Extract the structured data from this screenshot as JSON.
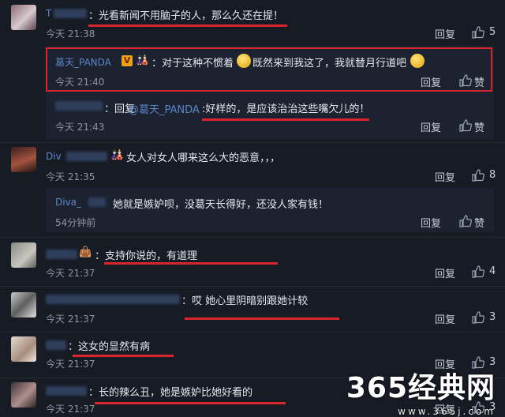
{
  "comments": [
    {
      "text": "：光看新闻不用脑子的人，那么久还在提！",
      "time": "今天 21:38",
      "reply": "回复",
      "likes": "5"
    },
    {
      "text": "女人对女人哪来这么大的恶意，，，",
      "time": "今天 21:35",
      "reply": "回复",
      "likes": "8"
    },
    {
      "text": "：支持你说的，有道理",
      "time": "今天 21:37",
      "reply": "回复",
      "likes": "4"
    },
    {
      "text": "：哎  她心里阴暗别跟她计较",
      "time": "今天 21:37",
      "reply": "回复",
      "likes": "3"
    },
    {
      "text": "：这女的显然有病",
      "time": "今天 21:37",
      "reply": "回复",
      "likes": "3"
    },
    {
      "text": "：长的辣么丑，她是嫉妒比她好看的",
      "time": "今天 21:37",
      "reply": "回复",
      "likes": "3"
    }
  ],
  "subreplies": [
    {
      "user": "葛天_PANDA",
      "text_a": "：对于这种不惯着",
      "text_b": "既然来到我这了，我就替月行道吧",
      "time": "今天 21:40",
      "reply": "回复",
      "like": "赞"
    },
    {
      "prefix": "：回复",
      "mention": "@葛天_PANDA",
      "text": ":好样的，是应该治治这些嘴欠儿的！",
      "time": "今天 21:43",
      "reply": "回复",
      "like": "赞"
    },
    {
      "user": "Diva_",
      "text": "她就是嫉妒呗，没葛天长得好，还没人家有钱！",
      "time": "54分钟前",
      "reply": "回复",
      "like": "赞"
    }
  ],
  "user_fragments": {
    "c1": "T",
    "c2": "Div"
  },
  "badges": {
    "v": "V"
  },
  "watermark": {
    "main": "365经典网",
    "url": "www.365j.com"
  },
  "colors": {
    "accent": "#5a86c6",
    "highlight": "#d7262b"
  },
  "icons": [
    "thumbs-up-icon",
    "emoji-face-icon"
  ]
}
